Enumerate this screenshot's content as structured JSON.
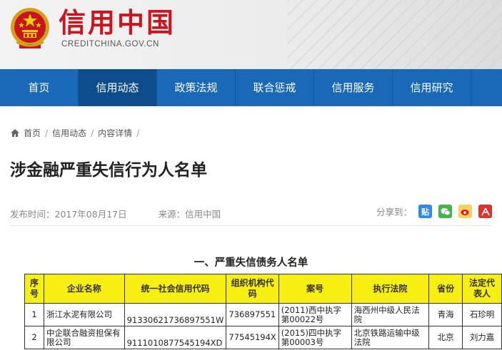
{
  "header": {
    "site_name": "信用中国",
    "site_domain": "CREDITCHINA.GOV.CN",
    "emblem_icon": "national-emblem-icon"
  },
  "nav": {
    "items": [
      {
        "label": "首页",
        "active": false
      },
      {
        "label": "信用动态",
        "active": true
      },
      {
        "label": "政策法规",
        "active": false
      },
      {
        "label": "联合惩戒",
        "active": false
      },
      {
        "label": "信用服务",
        "active": false
      },
      {
        "label": "信用研究",
        "active": false
      }
    ]
  },
  "breadcrumb": {
    "items": [
      "首页",
      "信用动态",
      "内容详情"
    ],
    "separator": "/"
  },
  "article": {
    "title": "涉金融严重失信行为人名单",
    "publish_time": "发布时间：2017年08月17日",
    "source": "来源：信用中国",
    "share_label": "分享到：",
    "share_icons": [
      "tieba-icon",
      "wechat-icon",
      "weibo-icon",
      "renren-icon"
    ]
  },
  "content": {
    "section_title": "一、严重失信债务人名单",
    "table": {
      "headers": [
        "序号",
        "企业名称",
        "统一社会信用代码",
        "组织机构代码",
        "案号",
        "执行法院",
        "省份",
        "法定代表人"
      ],
      "rows": [
        [
          "1",
          "浙江水泥有限公司",
          "91330621736897551W",
          "736897551",
          "(2011)西中执字第00022号",
          "海西州中级人民法院",
          "青海",
          "石珍明"
        ],
        [
          "2",
          "中企联合融资担保有限公司",
          "9111010877545194XD",
          "77545194X",
          "(2015)四中执字第00003号",
          "北京铁路运输中级法院",
          "北京",
          "刘力嘉"
        ]
      ]
    }
  },
  "colors": {
    "brand_red": "#c7161e",
    "nav_blue": "#1a69b8",
    "nav_active": "#0d4d8c",
    "table_header_yellow": "#f8ef12"
  }
}
